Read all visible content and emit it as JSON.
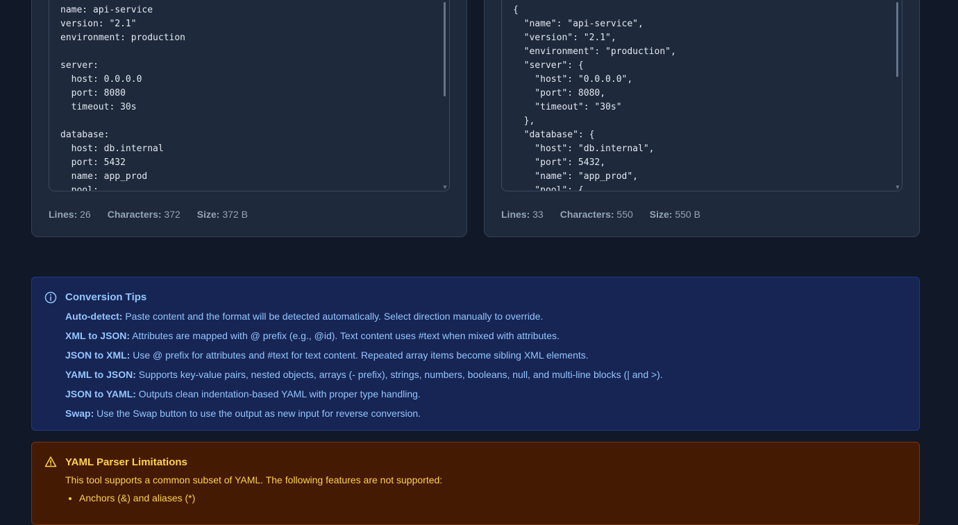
{
  "input_panel": {
    "code": "name: api-service\nversion: \"2.1\"\nenvironment: production\n\nserver:\n  host: 0.0.0.0\n  port: 8080\n  timeout: 30s\n\ndatabase:\n  host: db.internal\n  port: 5432\n  name: app_prod\n  pool:",
    "stats": {
      "lines_label": "Lines:",
      "lines": "26",
      "chars_label": "Characters:",
      "chars": "372",
      "size_label": "Size:",
      "size": "372 B"
    }
  },
  "output_panel": {
    "code": "{\n  \"name\": \"api-service\",\n  \"version\": \"2.1\",\n  \"environment\": \"production\",\n  \"server\": {\n    \"host\": \"0.0.0.0\",\n    \"port\": 8080,\n    \"timeout\": \"30s\"\n  },\n  \"database\": {\n    \"host\": \"db.internal\",\n    \"port\": 5432,\n    \"name\": \"app_prod\",\n    \"pool\": {",
    "stats": {
      "lines_label": "Lines:",
      "lines": "33",
      "chars_label": "Characters:",
      "chars": "550",
      "size_label": "Size:",
      "size": "550 B"
    }
  },
  "tips": {
    "icon": "info-icon",
    "title": "Conversion Tips",
    "items": [
      {
        "key": "Auto-detect:",
        "text": " Paste content and the format will be detected automatically. Select direction manually to override."
      },
      {
        "key": "XML to JSON:",
        "text": " Attributes are mapped with @ prefix (e.g., @id). Text content uses #text when mixed with attributes."
      },
      {
        "key": "JSON to XML:",
        "text": " Use @ prefix for attributes and #text for text content. Repeated array items become sibling XML elements."
      },
      {
        "key": "YAML to JSON:",
        "text": " Supports key-value pairs, nested objects, arrays (- prefix), strings, numbers, booleans, null, and multi-line blocks (| and >)."
      },
      {
        "key": "JSON to YAML:",
        "text": " Outputs clean indentation-based YAML with proper type handling."
      },
      {
        "key": "Swap:",
        "text": " Use the Swap button to use the output as new input for reverse conversion."
      }
    ]
  },
  "warning": {
    "icon": "warning-icon",
    "title": "YAML Parser Limitations",
    "description": "This tool supports a common subset of YAML. The following features are not supported:",
    "items": [
      "Anchors (&) and aliases (*)"
    ]
  },
  "colors": {
    "background": "#111827",
    "panel": "#1e293b",
    "tips_bg": "#172554",
    "tips_text": "#93c5fd",
    "warn_bg": "#451a03",
    "warn_text": "#fcd34d"
  }
}
